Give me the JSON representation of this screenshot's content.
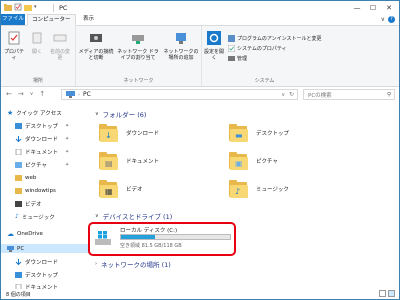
{
  "window": {
    "title": "PC"
  },
  "tabs": {
    "file": "ファイル",
    "computer": "コンピューター",
    "view": "表示"
  },
  "ribbon": {
    "properties": "プロパティ",
    "open": "開く",
    "rename": "名前の変更",
    "location_label": "場所",
    "media_access": "メディアの接続と切断",
    "map_drive": "ネットワーク ドライブの割り当て",
    "add_network_location": "ネットワークの場所の追加",
    "network_label": "ネットワーク",
    "open_settings": "設定を開く",
    "uninstall": "プログラムのアンインストールと変更",
    "system_properties": "システムのプロパティ",
    "manage": "管理",
    "system_label": "システム"
  },
  "address": {
    "path": "PC",
    "search_placeholder": "PCの検索"
  },
  "navpane": {
    "quick_access": "クイック アクセス",
    "items": [
      "デスクトップ",
      "ダウンロード",
      "ドキュメント",
      "ピクチャ",
      "web",
      "windowtips",
      "ビデオ",
      "ミュージック"
    ],
    "onedrive": "OneDrive",
    "pc": "PC",
    "pc_items": [
      "ダウンロード",
      "デスクトップ",
      "ドキュメント"
    ]
  },
  "content": {
    "folders_header": "フォルダー (6)",
    "folders": [
      "ダウンロード",
      "デスクトップ",
      "ドキュメント",
      "ピクチャ",
      "ビデオ",
      "ミュージック"
    ],
    "devices_header": "デバイスとドライブ (1)",
    "drive": {
      "name": "ローカル ディスク (C:)",
      "free_text": "空き領域 81.5 GB/118 GB",
      "used_fraction": 0.31
    },
    "network_header": "ネットワークの場所 (1)"
  },
  "status": {
    "items": "8 個の項目"
  },
  "colors": {
    "accent": "#1979ca",
    "highlight": "#e60012",
    "drive_fill": "#26a0da"
  }
}
